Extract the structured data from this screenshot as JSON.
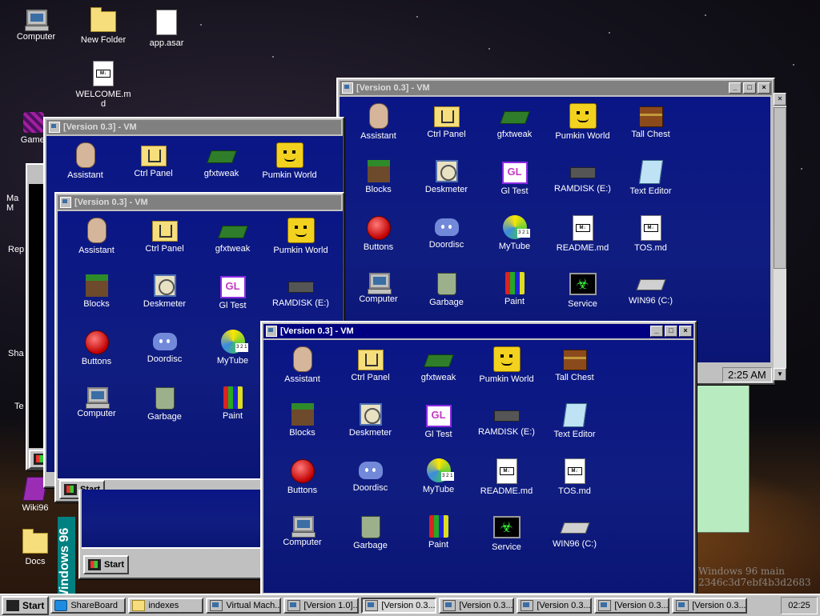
{
  "desktop": {
    "icons": [
      {
        "label": "Computer"
      },
      {
        "label": "New Folder"
      },
      {
        "label": "app.asar"
      },
      {
        "label": "WELCOME.md"
      },
      {
        "label": "Gamei"
      },
      {
        "label": "Wiki96"
      },
      {
        "label": "Docs"
      }
    ],
    "partial_labels": [
      "Ma",
      "M",
      "Rep",
      "Sha",
      "Te"
    ],
    "win96_banner": "Windows 96",
    "watermark_line1": "Windows 96 main",
    "watermark_line2": "2346c3d7ebf4b3d2683"
  },
  "vm_window": {
    "title": "[Version 0.3] - VM",
    "icons": [
      {
        "label": "Assistant",
        "icon": "assistant-icon"
      },
      {
        "label": "Ctrl Panel",
        "icon": "ctrl-panel-icon"
      },
      {
        "label": "gfxtweak",
        "icon": "gfxtweak-icon"
      },
      {
        "label": "Pumkin World",
        "icon": "pumpkin-icon"
      },
      {
        "label": "Tall Chest",
        "icon": "chest-icon"
      },
      {
        "label": "Blocks",
        "icon": "blocks-icon"
      },
      {
        "label": "Deskmeter",
        "icon": "deskmeter-icon"
      },
      {
        "label": "Gl Test",
        "icon": "gltest-icon"
      },
      {
        "label": "RAMDISK (E:)",
        "icon": "ramdisk-icon"
      },
      {
        "label": "Text Editor",
        "icon": "text-editor-icon"
      },
      {
        "label": "Buttons",
        "icon": "buttons-icon"
      },
      {
        "label": "Doordisc",
        "icon": "doordisc-icon"
      },
      {
        "label": "MyTube",
        "icon": "mytube-icon"
      },
      {
        "label": "README.md",
        "icon": "markdown-file-icon"
      },
      {
        "label": "TOS.md",
        "icon": "markdown-file-icon"
      },
      {
        "label": "Computer",
        "icon": "computer-icon"
      },
      {
        "label": "Garbage",
        "icon": "garbage-icon"
      },
      {
        "label": "Paint",
        "icon": "paint-icon"
      },
      {
        "label": "Service",
        "icon": "service-icon"
      },
      {
        "label": "WIN96 (C:)",
        "icon": "drive-icon"
      }
    ],
    "start_label": "Start",
    "clock": "2:25 AM",
    "gl_text": "GL",
    "md_text": "M↓"
  },
  "taskbar": {
    "start_label": "Start",
    "items": [
      {
        "label": "ShareBoard",
        "pressed": false
      },
      {
        "label": "indexes",
        "pressed": false
      },
      {
        "label": "Virtual Mach...",
        "pressed": false
      },
      {
        "label": "[Version 1.0]...",
        "pressed": false
      },
      {
        "label": "[Version 0.3...",
        "pressed": true
      },
      {
        "label": "[Version 0.3...",
        "pressed": false
      },
      {
        "label": "[Version 0.3...",
        "pressed": false
      },
      {
        "label": "[Version 0.3...",
        "pressed": false
      },
      {
        "label": "[Version 0.3...",
        "pressed": false
      }
    ],
    "clock": "02:25"
  },
  "colors": {
    "vm_blue": "#0f1e86",
    "title_active": "#000080",
    "title_inactive": "#808080",
    "chrome": "#c0c0c0"
  }
}
